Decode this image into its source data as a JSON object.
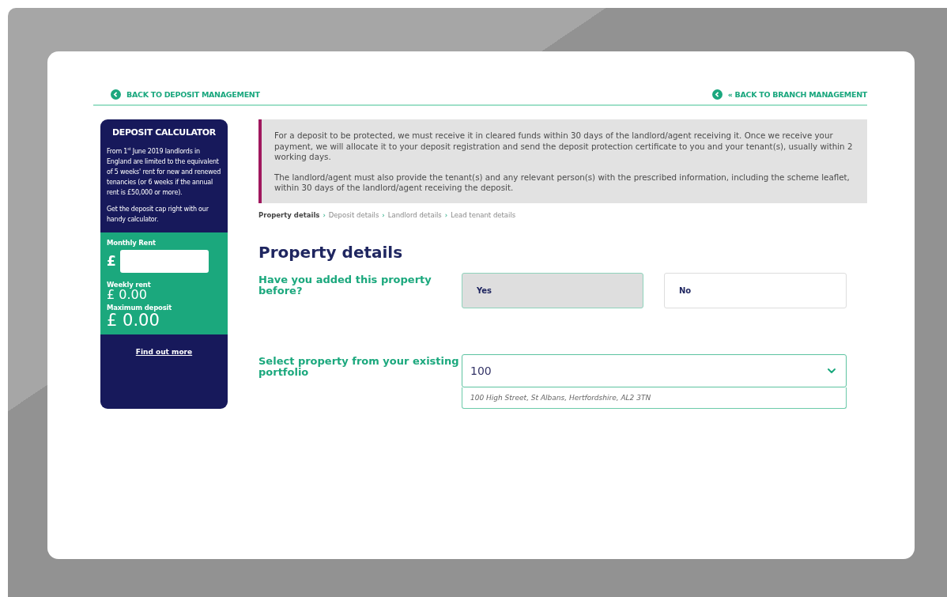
{
  "top_links": [
    {
      "label": "BACK TO DEPOSIT MANAGEMENT"
    },
    {
      "label": "« BACK TO BRANCH MANAGEMENT"
    }
  ],
  "calculator": {
    "title": "DEPOSIT CALCULATOR",
    "paragraphs": [
      "From 1$^{st}$ June 2019 landlords in England are limited to the equivalent of 5 weeks' rent for new and renewed tenancies (or 6 weeks if the annual rent is £50,000 or more).",
      "Get the deposit cap right with our handy calculator."
    ],
    "monthly_rent_label": "Monthly Rent",
    "currency": "£",
    "weekly_rent_label": "Weekly rent",
    "weekly_rent": "£ 0.00",
    "max_deposit_label": "Maximum deposit",
    "max_deposit": "£ 0.00",
    "link": "Find out more"
  },
  "notice": [
    "For a deposit to be protected, we must receive it in cleared funds within 30 days of the landlord/agent receiving it. Once we receive your payment, we will allocate it to your deposit registration and send the deposit protection certificate to you and your tenant(s), usually within 2 working days.",
    "The landlord/agent must also provide the tenant(s) and any relevant person(s) with the prescribed information, including the scheme leaflet, within 30 days of the landlord/agent receiving the deposit."
  ],
  "breadcrumb": [
    {
      "label": "Property details",
      "selected": true
    },
    {
      "label": "Deposit details",
      "selected": false
    },
    {
      "label": "Landlord details",
      "selected": false
    },
    {
      "label": "Lead tenant details",
      "selected": false
    }
  ],
  "breadcrumb_separator": "›",
  "heading": "Property details",
  "question": {
    "label": "Have you added this property before?",
    "options": [
      {
        "label": "Yes",
        "selected": true
      },
      {
        "label": "No",
        "selected": false
      }
    ]
  },
  "select": {
    "label": "Select property from your existing portfolio",
    "value": "100",
    "suggestion": "100 High Street, St Albans, Hertfordshire, AL2 3TN"
  }
}
